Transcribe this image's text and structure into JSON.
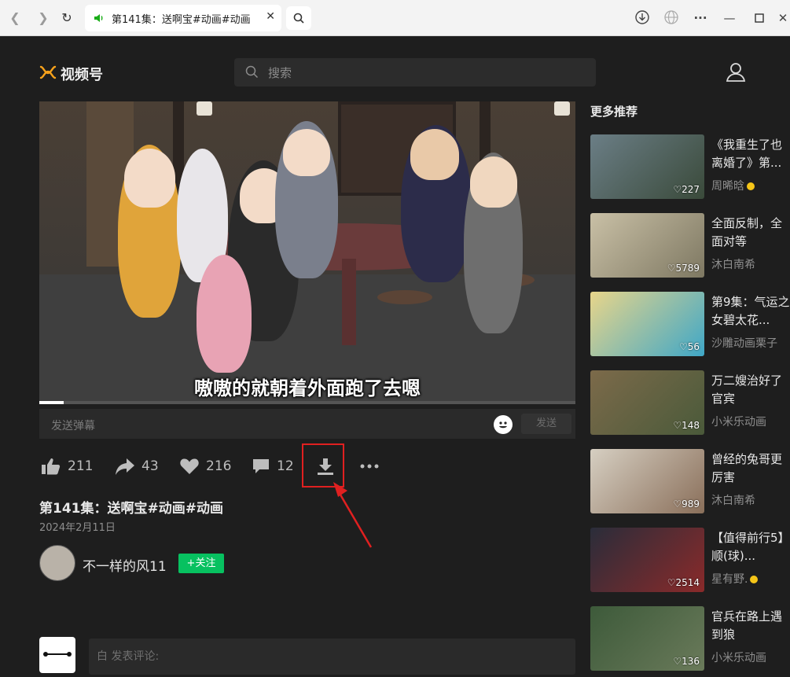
{
  "browser": {
    "tab_title": "第141集：送啊宝#动画#动画",
    "tab_close": "✕"
  },
  "header": {
    "logo_text": "视频号",
    "search_placeholder": "搜索"
  },
  "player": {
    "subtitle": "嗷嗷的就朝着外面跑了去嗯",
    "progress": 0.045,
    "danmaku_placeholder": "发送弹幕",
    "send_label": "发送"
  },
  "actions": {
    "likes": "211",
    "shares": "43",
    "favorites": "216",
    "comments": "12"
  },
  "video": {
    "title": "第141集：送啊宝#动画#动画",
    "date": "2024年2月11日",
    "author": "不一样的风11",
    "follow_label": "+关注"
  },
  "comment": {
    "placeholder": "白 发表评论:"
  },
  "sidebar": {
    "heading": "更多推荐",
    "items": [
      {
        "title": "《我重生了也离婚了》第...",
        "author": "周晞晗",
        "likes": "227",
        "verified": true,
        "color_a": "#6b7e86",
        "color_b": "#3a4a3a"
      },
      {
        "title": "全面反制，全面对等",
        "author": "沐白南希",
        "likes": "5789",
        "verified": false,
        "color_a": "#c9c0a6",
        "color_b": "#7e7862"
      },
      {
        "title": "第9集：气运之女碧太花...",
        "author": "沙雕动画栗子",
        "likes": "56",
        "verified": false,
        "color_a": "#e8d58a",
        "color_b": "#3fa7c7"
      },
      {
        "title": "万二嫂治好了官宾",
        "author": "小米乐动画",
        "likes": "148",
        "verified": false,
        "color_a": "#7c6a4a",
        "color_b": "#4a5a3a"
      },
      {
        "title": "曾经的兔哥更厉害",
        "author": "沐白南希",
        "likes": "989",
        "verified": false,
        "color_a": "#d6cfc2",
        "color_b": "#8a6f5a"
      },
      {
        "title": "【值得前行5】顺(球)...",
        "author": "星有野.",
        "likes": "2514",
        "verified": true,
        "color_a": "#2a2d3a",
        "color_b": "#8a2a2a"
      },
      {
        "title": "官兵在路上遇到狼",
        "author": "小米乐动画",
        "likes": "136",
        "verified": false,
        "color_a": "#3d5a3a",
        "color_b": "#6a7a5a"
      }
    ]
  }
}
